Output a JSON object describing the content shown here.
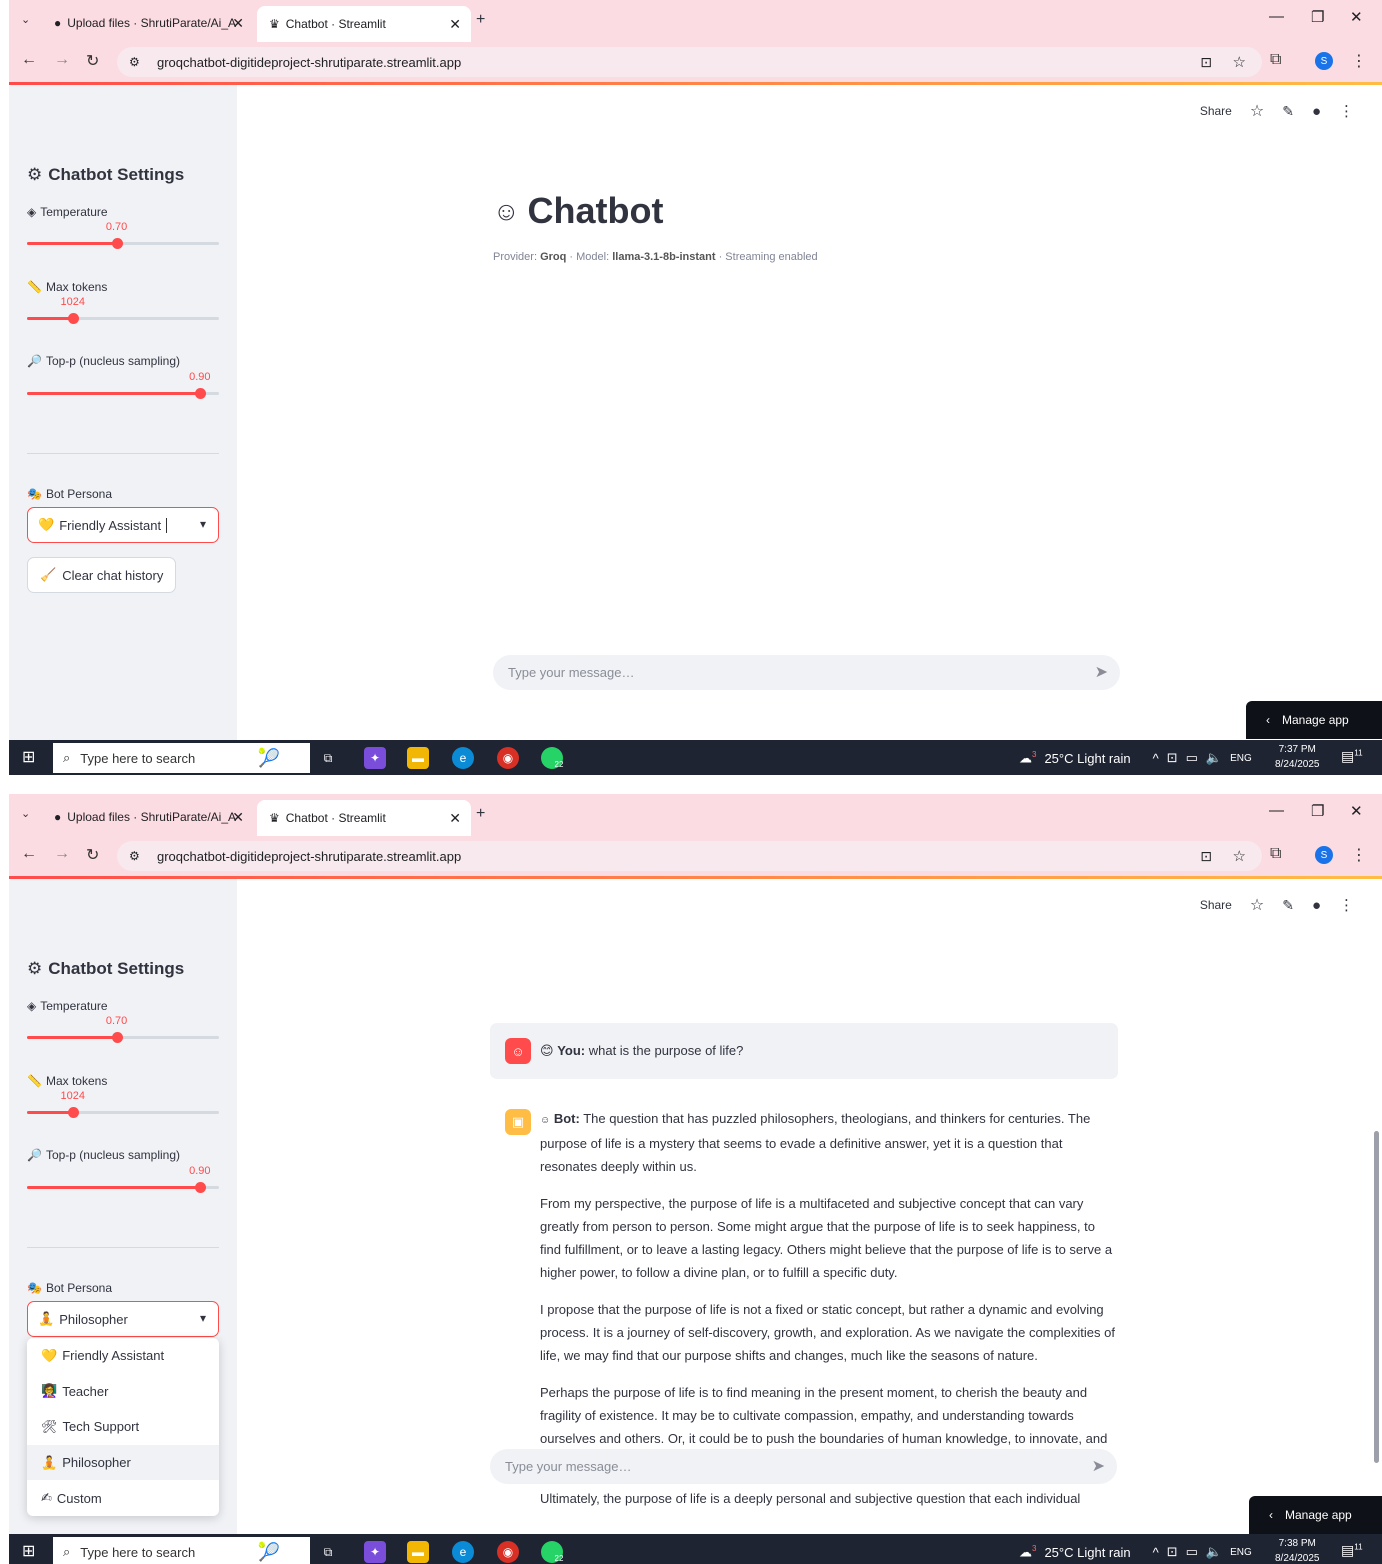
{
  "browser": {
    "tabs": [
      {
        "title": "Upload files · ShrutiParate/Ai_A",
        "icon": "github-icon"
      },
      {
        "title": "Chatbot · Streamlit",
        "icon": "streamlit-icon"
      }
    ],
    "url": "groqchatbot-digitideproject-shrutiparate.streamlit.app"
  },
  "toolbar": {
    "share_label": "Share"
  },
  "sidebar": {
    "title": "Chatbot Settings",
    "temperature": {
      "label": "Temperature",
      "value_text": "0.70",
      "value": 0.7,
      "min": 0,
      "max": 1.5
    },
    "max_tokens": {
      "label": "Max tokens",
      "value_text": "1024",
      "value": 1024,
      "min": 64,
      "max": 4096
    },
    "top_p": {
      "label": "Top-p (nucleus sampling)",
      "value_text": "0.90",
      "value": 0.9,
      "min": 0,
      "max": 1
    },
    "persona_label": "Bot Persona",
    "persona_selected_1": "Friendly Assistant",
    "persona_selected_2": "Philosopher",
    "clear_label": "Clear chat history",
    "persona_options": [
      "Friendly Assistant",
      "Teacher",
      "Tech Support",
      "Philosopher",
      "Custom"
    ]
  },
  "main": {
    "title": "Chatbot",
    "caption": {
      "provider_label": "Provider: ",
      "provider": "Groq",
      "model_label": " · Model: ",
      "model": "llama-3.1-8b-instant",
      "suffix": " · Streaming enabled"
    },
    "input_placeholder": "Type your message…",
    "manage_label": "Manage app"
  },
  "chat": {
    "user_label": "You:",
    "user_text": " what is the purpose of life?",
    "bot_label": "Bot:",
    "bot_paragraphs": [
      " The question that has puzzled philosophers, theologians, and thinkers for centuries. The purpose of life is a mystery that seems to evade a definitive answer, yet it is a question that resonates deeply within us.",
      "From my perspective, the purpose of life is a multifaceted and subjective concept that can vary greatly from person to person. Some might argue that the purpose of life is to seek happiness, to find fulfillment, or to leave a lasting legacy. Others might believe that the purpose of life is to serve a higher power, to follow a divine plan, or to fulfill a specific duty.",
      "I propose that the purpose of life is not a fixed or static concept, but rather a dynamic and evolving process. It is a journey of self-discovery, growth, and exploration. As we navigate the complexities of life, we may find that our purpose shifts and changes, much like the seasons of nature.",
      "Perhaps the purpose of life is to find meaning in the present moment, to cherish the beauty and fragility of existence. It may be to cultivate compassion, empathy, and understanding towards ourselves and others. Or, it could be to push the boundaries of human knowledge, to innovate, and to create something new and original.",
      "Ultimately, the purpose of life is a deeply personal and subjective question that each individual"
    ]
  },
  "taskbar": {
    "search_placeholder": "Type here to search",
    "weather": "25°C  Light rain",
    "lang": "ENG",
    "whatsapp_badge": "22",
    "weather_badge": "3",
    "notif_badge": "11",
    "time_1": "7:37 PM",
    "time_2": "7:38 PM",
    "date": "8/24/2025"
  }
}
